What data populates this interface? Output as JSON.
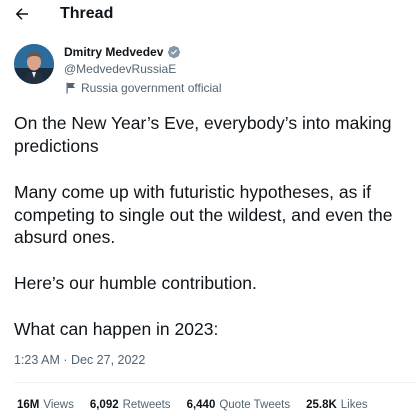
{
  "header": {
    "title": "Thread",
    "back_icon": "arrow-left-icon"
  },
  "author": {
    "name": "Dmitry Medvedev",
    "handle": "@MedvedevRussiaE",
    "label": "Russia government official",
    "verified_color": "#829aab"
  },
  "tweet": {
    "paragraphs": [
      [
        "On the New Year’s Eve, everybody’s into making",
        "predictions"
      ],
      [
        "Many come up with futuristic hypotheses, as if",
        "competing to single out the wildest, and even the",
        "absurd ones."
      ],
      [
        "Here’s our humble contribution."
      ],
      [
        "What can happen in 2023:"
      ]
    ],
    "timestamp": "1:23 AM · Dec 27, 2022"
  },
  "stats": [
    {
      "num": "16M",
      "label": "Views"
    },
    {
      "num": "6,092",
      "label": "Retweets"
    },
    {
      "num": "6,440",
      "label": "Quote Tweets"
    },
    {
      "num": "25.8K",
      "label": "Likes"
    }
  ],
  "colors": {
    "text": "#0f1419",
    "secondary": "#536471",
    "divider": "#eff3f4"
  }
}
